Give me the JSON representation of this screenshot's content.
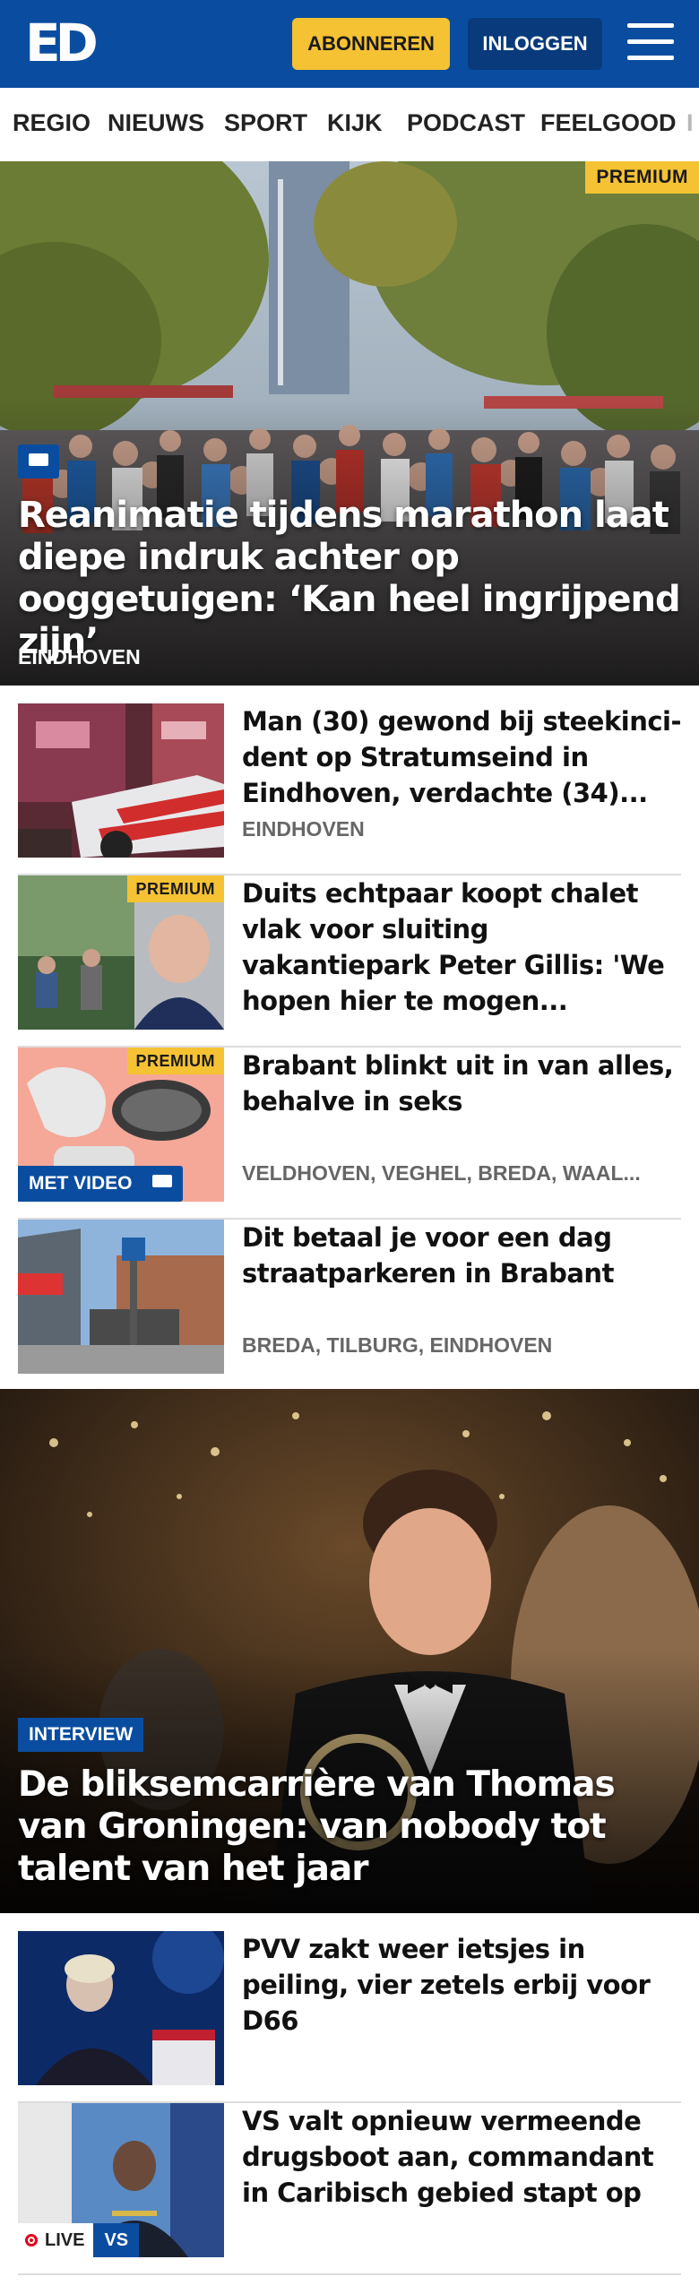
{
  "header": {
    "logo": "ED",
    "subscribe_label": "ABONNEREN",
    "login_label": "INLOGGEN"
  },
  "nav": {
    "items": [
      "REGIO",
      "NIEUWS",
      "SPORT",
      "KIJK",
      "PODCAST",
      "FEELGOOD"
    ]
  },
  "hero": {
    "badge": "PREMIUM",
    "title": "Reanimatie tijdens marathon laat diepe indruk achter op ooggetuigen: ‘Kan heel ingrijpend zijn’",
    "location": "EINDHOVEN"
  },
  "articles": [
    {
      "title": "Man (30) gewond bij steekinci-dent op Stratumseind in Eindhoven, verdachte (34)...",
      "location": "EINDHOVEN"
    },
    {
      "title": "Duits echtpaar koopt chalet vlak voor sluiting vakantiepark Peter Gillis: 'We hopen hier te mogen...",
      "badge": "PREMIUM"
    },
    {
      "title": "Brabant blinkt uit in van alles, behalve in seks",
      "location": "VELDHOVEN, VEGHEL, BREDA, WAAL...",
      "badge": "PREMIUM",
      "video_badge": "MET VIDEO"
    },
    {
      "title": "Dit betaal je voor een dag straatparkeren in Brabant",
      "location": "BREDA, TILBURG, EINDHOVEN"
    }
  ],
  "feature": {
    "badge": "INTERVIEW",
    "title": "De bliksemcarrière van Thomas van Groningen: van nobody tot talent van het jaar"
  },
  "articles2": [
    {
      "title": "PVV zakt weer ietsjes in peiling, vier zetels erbij voor D66"
    },
    {
      "title": "VS valt opnieuw vermeende drugsboot aan, commandant in Caribisch gebied stapt op",
      "live_label": "LIVE",
      "tag": "VS"
    }
  ],
  "colors": {
    "brand_blue": "#0a4da0",
    "premium_yellow": "#f5c234",
    "live_red": "#e2001a"
  }
}
